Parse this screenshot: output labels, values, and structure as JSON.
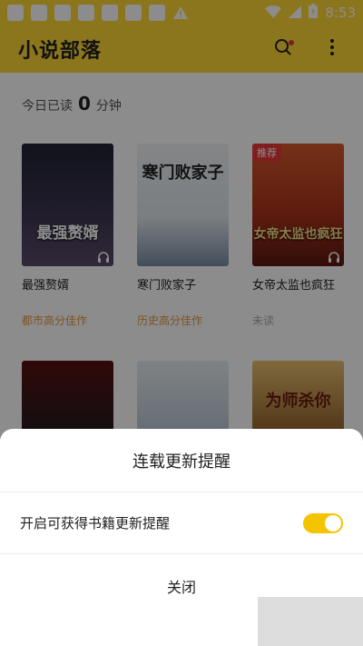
{
  "status_bar": {
    "time": "8:53",
    "icons": [
      "notification-square-icon",
      "notification-square-icon",
      "notification-square-icon",
      "notification-square-icon",
      "notification-square-icon",
      "notification-square-icon",
      "notification-square-icon",
      "warning-icon",
      "wifi-icon",
      "signal-icon",
      "battery-charging-icon"
    ]
  },
  "app_bar": {
    "title": "小说部落",
    "search_icon": "search-icon",
    "more_icon": "more-vert-icon"
  },
  "reading": {
    "prefix": "今日已读",
    "minutes": "0",
    "suffix": "分钟"
  },
  "books": [
    {
      "cover_title": "最强赘婿",
      "name": "最强赘婿",
      "subtitle": "都市高分佳作",
      "tag": "",
      "has_audio": true,
      "cover_color": "#2b2a3a"
    },
    {
      "cover_title": "寒门败家子",
      "name": "寒门败家子",
      "subtitle": "历史高分佳作",
      "tag": "",
      "has_audio": false,
      "cover_color": "#e6ebef"
    },
    {
      "cover_title": "女帝太监也疯狂",
      "name": "女帝太监也疯狂",
      "subtitle": "未读",
      "tag": "推荐",
      "has_audio": true,
      "cover_color": "#b23a1e"
    },
    {
      "cover_title": "",
      "name": "",
      "subtitle": "",
      "tag": "",
      "has_audio": false,
      "cover_color": "#2a2228"
    },
    {
      "cover_title": "",
      "name": "",
      "subtitle": "",
      "tag": "",
      "has_audio": false,
      "cover_color": "#c7d1db"
    },
    {
      "cover_title": "为师杀你",
      "name": "",
      "subtitle": "",
      "tag": "",
      "has_audio": false,
      "cover_color": "#6a4a2a"
    }
  ],
  "sheet": {
    "title": "连载更新提醒",
    "row_label": "开启可获得书籍更新提醒",
    "toggle_on": true,
    "close_label": "关闭"
  },
  "colors": {
    "accent": "#fdd835",
    "toggle": "#f5c400",
    "subtitle": "#e09a3c"
  }
}
